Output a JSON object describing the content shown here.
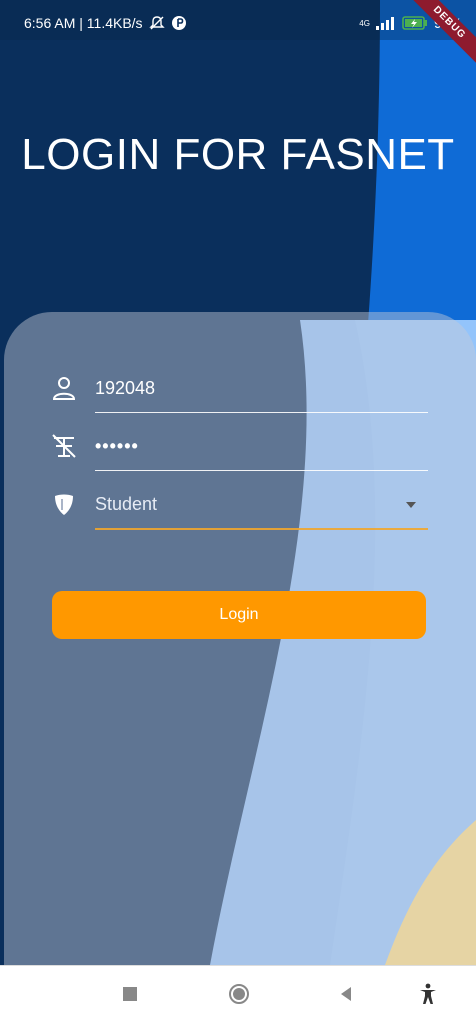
{
  "status": {
    "time_speed": "6:56 AM | 11.4KB/s",
    "network": "4G",
    "battery": "98%",
    "debug_label": "DEBUG"
  },
  "title": "LOGIN FOR FASNET",
  "form": {
    "user_id": "192048",
    "password_mask": "••••••",
    "role": "Student"
  },
  "login_button": "Login",
  "colors": {
    "accent": "#ff9800",
    "dark_blue": "#0a2f5c",
    "blue": "#0f6bd6",
    "light_blue": "#8cbdf7",
    "sand": "#ffda7a"
  }
}
